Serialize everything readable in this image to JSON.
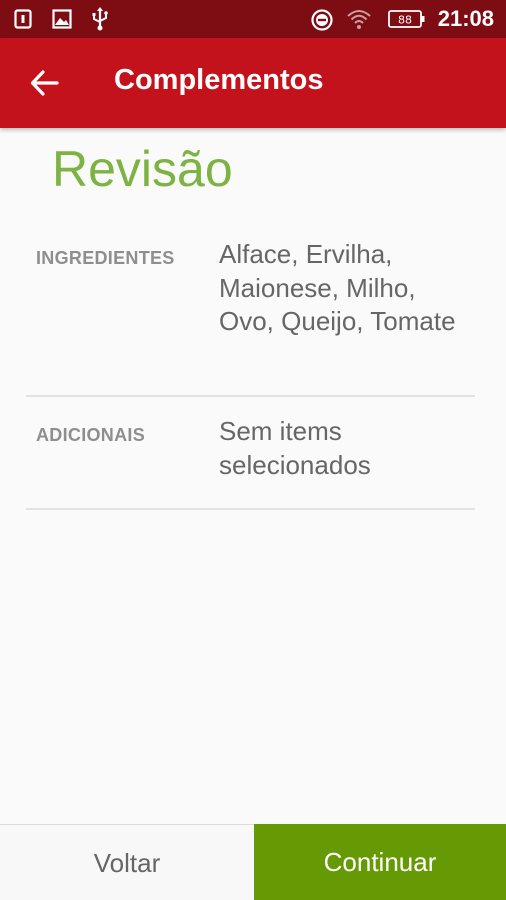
{
  "status_bar": {
    "time": "21:08",
    "battery_level": "88",
    "icons": [
      "sim-icon",
      "image-icon",
      "usb-icon",
      "do-not-disturb-icon",
      "wifi-icon",
      "battery-icon"
    ]
  },
  "app_bar": {
    "title": "Complementos",
    "back_icon": "arrow-back-icon"
  },
  "review": {
    "title": "Revisão",
    "rows": [
      {
        "label": "INGREDIENTES",
        "value": "Alface, Ervilha, Maionese, Milho, Ovo, Queijo, Tomate"
      },
      {
        "label": "ADICIONAIS",
        "value": "Sem items selecionados"
      }
    ]
  },
  "actions": {
    "back_label": "Voltar",
    "continue_label": "Continuar"
  },
  "colors": {
    "status_bar": "#7e0c13",
    "app_bar": "#c4121c",
    "accent_green": "#669a05",
    "title_green": "#7cb342"
  }
}
